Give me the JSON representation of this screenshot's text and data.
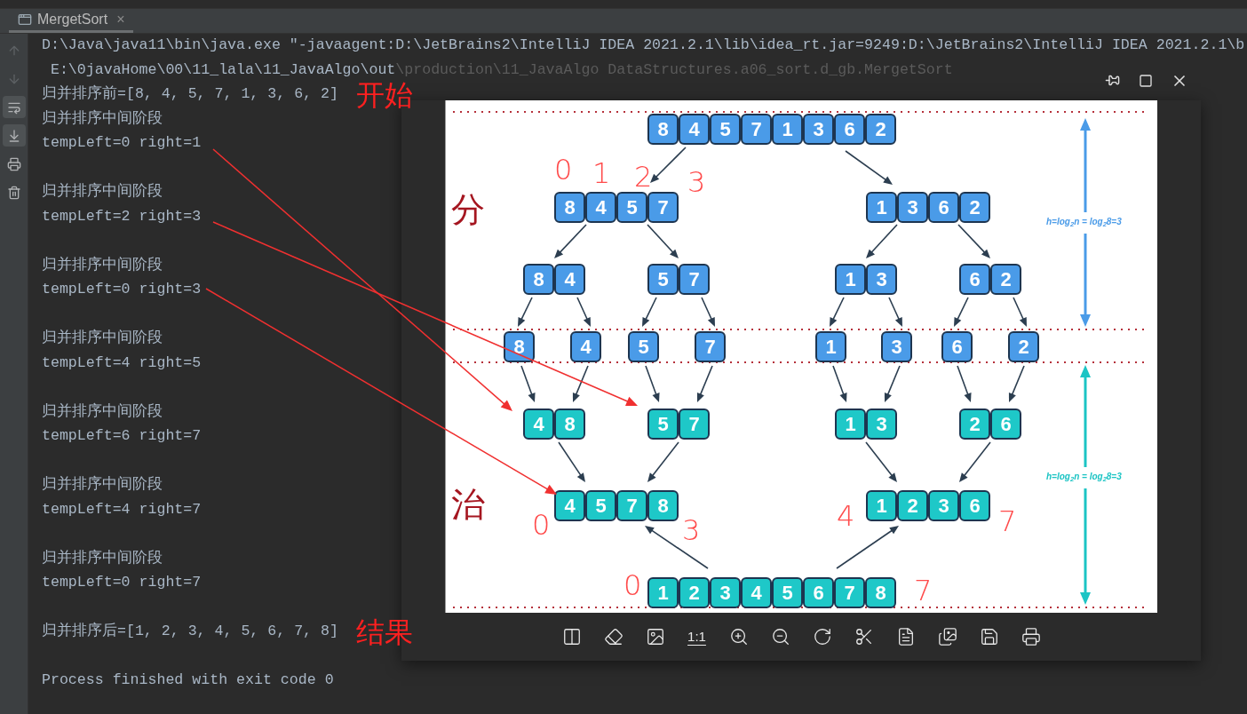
{
  "tab": {
    "title": "MergetSort",
    "close": "×"
  },
  "toolbar": [
    {
      "selected": false,
      "disabled": true
    },
    {
      "selected": false,
      "disabled": true
    },
    {
      "selected": true,
      "disabled": false
    },
    {
      "selected": true,
      "disabled": false
    },
    {
      "selected": false,
      "disabled": false
    },
    {
      "selected": false,
      "disabled": false
    }
  ],
  "console": [
    {
      "kind": "command",
      "text": "D:\\Java\\java11\\bin\\java.exe \"-javaagent:D:\\JetBrains2\\IntelliJ IDEA 2021.2.1\\lib\\idea_rt.jar=9249:D:\\JetBrains2\\IntelliJ IDEA 2021.2.1\\b"
    },
    {
      "kind": "continuation",
      "text": "E:\\0javaHome\\00\\11_lala\\11_JavaAlgo\\out",
      "covered_text": "\\production\\11_JavaAlgo DataStructures.a06_sort.d_gb.MergetSort"
    },
    {
      "kind": "output",
      "text": "归并排序前=[8, 4, 5, 7, 1, 3, 6, 2]",
      "note": "开始"
    },
    {
      "kind": "output",
      "text": "归并排序中间阶段"
    },
    {
      "kind": "output",
      "text": "tempLeft=0 right=1"
    },
    {
      "kind": "blank"
    },
    {
      "kind": "output",
      "text": "归并排序中间阶段"
    },
    {
      "kind": "output",
      "text": "tempLeft=2 right=3"
    },
    {
      "kind": "blank"
    },
    {
      "kind": "output",
      "text": "归并排序中间阶段"
    },
    {
      "kind": "output",
      "text": "tempLeft=0 right=3"
    },
    {
      "kind": "blank"
    },
    {
      "kind": "output",
      "text": "归并排序中间阶段"
    },
    {
      "kind": "output",
      "text": "tempLeft=4 right=5"
    },
    {
      "kind": "blank"
    },
    {
      "kind": "output",
      "text": "归并排序中间阶段"
    },
    {
      "kind": "output",
      "text": "tempLeft=6 right=7"
    },
    {
      "kind": "blank"
    },
    {
      "kind": "output",
      "text": "归并排序中间阶段"
    },
    {
      "kind": "output",
      "text": "tempLeft=4 right=7"
    },
    {
      "kind": "blank"
    },
    {
      "kind": "output",
      "text": "归并排序中间阶段"
    },
    {
      "kind": "output",
      "text": "tempLeft=0 right=7"
    },
    {
      "kind": "blank"
    },
    {
      "kind": "output",
      "text": "归并排序后=[1, 2, 3, 4, 5, 6, 7, 8]",
      "note": "结果"
    },
    {
      "kind": "blank"
    },
    {
      "kind": "output",
      "text": "Process finished with exit code 0"
    }
  ],
  "viewer": {
    "toolbar": [
      {
        "kind": "icon"
      },
      {
        "kind": "icon"
      },
      {
        "kind": "icon"
      },
      {
        "kind": "text",
        "label": "1:1"
      },
      {
        "kind": "icon"
      },
      {
        "kind": "icon"
      },
      {
        "kind": "icon"
      },
      {
        "kind": "icon"
      },
      {
        "kind": "icon"
      },
      {
        "kind": "icon"
      },
      {
        "kind": "icon"
      },
      {
        "kind": "icon"
      }
    ],
    "diagram": {
      "divide_label": "分",
      "merge_label": "治",
      "height_labels": [
        "h=log$_{2}$n = log$_{2}$8=3",
        "h=log$_{2}$n = log$_{2}$8=3"
      ],
      "levels": [
        {
          "kind": "split",
          "groups": [
            [
              "8",
              "4",
              "5",
              "7",
              "1",
              "3",
              "6",
              "2"
            ]
          ]
        },
        {
          "kind": "split",
          "groups": [
            [
              "8",
              "4",
              "5",
              "7"
            ],
            [
              "1",
              "3",
              "6",
              "2"
            ]
          ]
        },
        {
          "kind": "split",
          "groups": [
            [
              "8",
              "4"
            ],
            [
              "5",
              "7"
            ],
            [
              "1",
              "3"
            ],
            [
              "6",
              "2"
            ]
          ]
        },
        {
          "kind": "split",
          "groups": [
            [
              "8"
            ],
            [
              "4"
            ],
            [
              "5"
            ],
            [
              "7"
            ],
            [
              "1"
            ],
            [
              "3"
            ],
            [
              "6"
            ],
            [
              "2"
            ]
          ]
        },
        {
          "kind": "merge",
          "groups": [
            [
              "4",
              "8"
            ],
            [
              "5",
              "7"
            ],
            [
              "1",
              "3"
            ],
            [
              "2",
              "6"
            ]
          ]
        },
        {
          "kind": "merge",
          "groups": [
            [
              "4",
              "5",
              "7",
              "8"
            ],
            [
              "1",
              "2",
              "3",
              "6"
            ]
          ]
        },
        {
          "kind": "merge",
          "groups": [
            [
              "1",
              "2",
              "3",
              "4",
              "5",
              "6",
              "7",
              "8"
            ]
          ]
        }
      ],
      "handwritten_marks": [
        "0",
        "1",
        "2",
        "3",
        "0",
        "3",
        "4",
        "7",
        "0",
        "7"
      ]
    }
  }
}
